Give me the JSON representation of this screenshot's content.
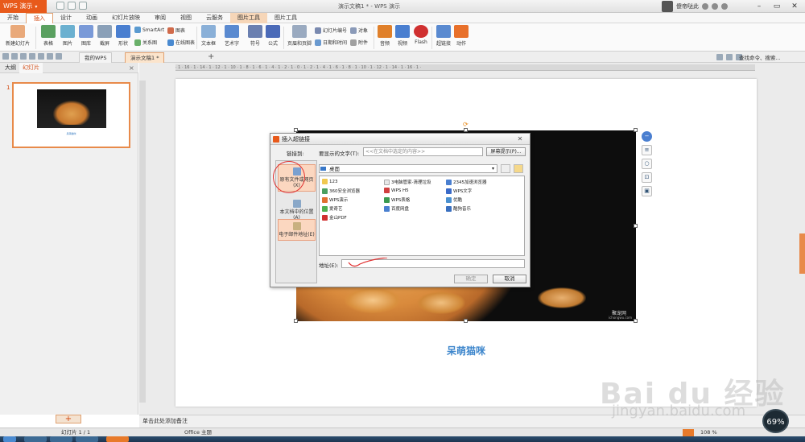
{
  "app": {
    "name": "WPS 演示",
    "window_title": "演示文稿1 * - WPS 演示",
    "user": "傻帝哒此",
    "colors": {
      "brand": "#e85a1b",
      "accent": "#3d86cc",
      "selection": "#fbd7c0"
    }
  },
  "menu_tabs": [
    "开始",
    "插入",
    "设计",
    "动画",
    "幻灯片放映",
    "审阅",
    "视图",
    "云服务",
    "图片工具",
    "图片工具"
  ],
  "active_tab": "插入",
  "ribbon": {
    "new_slide": "新建幻灯片",
    "table": "表格",
    "picture": "图片",
    "gallery": "图库",
    "screenshot": "截屏",
    "shapes": "形状",
    "smartart": "SmartArt",
    "chart": "图表",
    "relation": "关系图",
    "online_chart": "在线图表",
    "textbox": "文本框",
    "wordart": "艺术字",
    "symbol": "符号",
    "formula": "公式",
    "header_footer": "页眉和页脚",
    "slide_number": "幻灯片编号",
    "datetime": "日期和时间",
    "object": "对象",
    "attachment": "附件",
    "audio": "音频",
    "video": "视频",
    "flash": "Flash",
    "hyperlink": "超链接",
    "action": "动作"
  },
  "doc_tabs": [
    "我的WPS",
    "演示文稿1 *"
  ],
  "search_hint": "查找命令、搜索...",
  "left_panel": {
    "tab_outline": "大纲",
    "tab_slides": "幻灯片",
    "slide_index": "1",
    "thumb_caption": "呆萌猫咪"
  },
  "slide": {
    "caption": "呆萌猫咪",
    "watermark_logo": "聚宠网",
    "watermark_url": "ichongwu.com"
  },
  "dialog": {
    "title": "插入超链接",
    "link_to_label": "链接到:",
    "display_text_label": "要显示的文字(T):",
    "display_text_placeholder": "<<在文档中选定的内容>>",
    "screen_tip_button": "屏幕提示(P)...",
    "link_options": [
      {
        "label": "原有文件或网页(X)"
      },
      {
        "label": "本文档中的位置(A)"
      },
      {
        "label": "电子邮件地址(E)"
      }
    ],
    "look_in": "桌面",
    "files": [
      "123",
      "3电脑管家-清理垃圾",
      "2345加速浏览器",
      "360安全浏览器",
      "WPS H5",
      "WPS文字",
      "WPS演示",
      "WPS表格",
      "优酷",
      "爱奇艺",
      "百度网盘",
      "酷狗音乐",
      "金山PDF"
    ],
    "address_label": "地址(E):",
    "ok": "确定",
    "cancel": "取消"
  },
  "notes_placeholder": "单击此处添加备注",
  "status": {
    "slide": "幻灯片 1 / 1",
    "theme": "Office 主题",
    "zoom": "108 %"
  },
  "gauge": "69%",
  "baidu": {
    "logo": "Bai du 经验",
    "url": "jingyan.baidu.com"
  }
}
